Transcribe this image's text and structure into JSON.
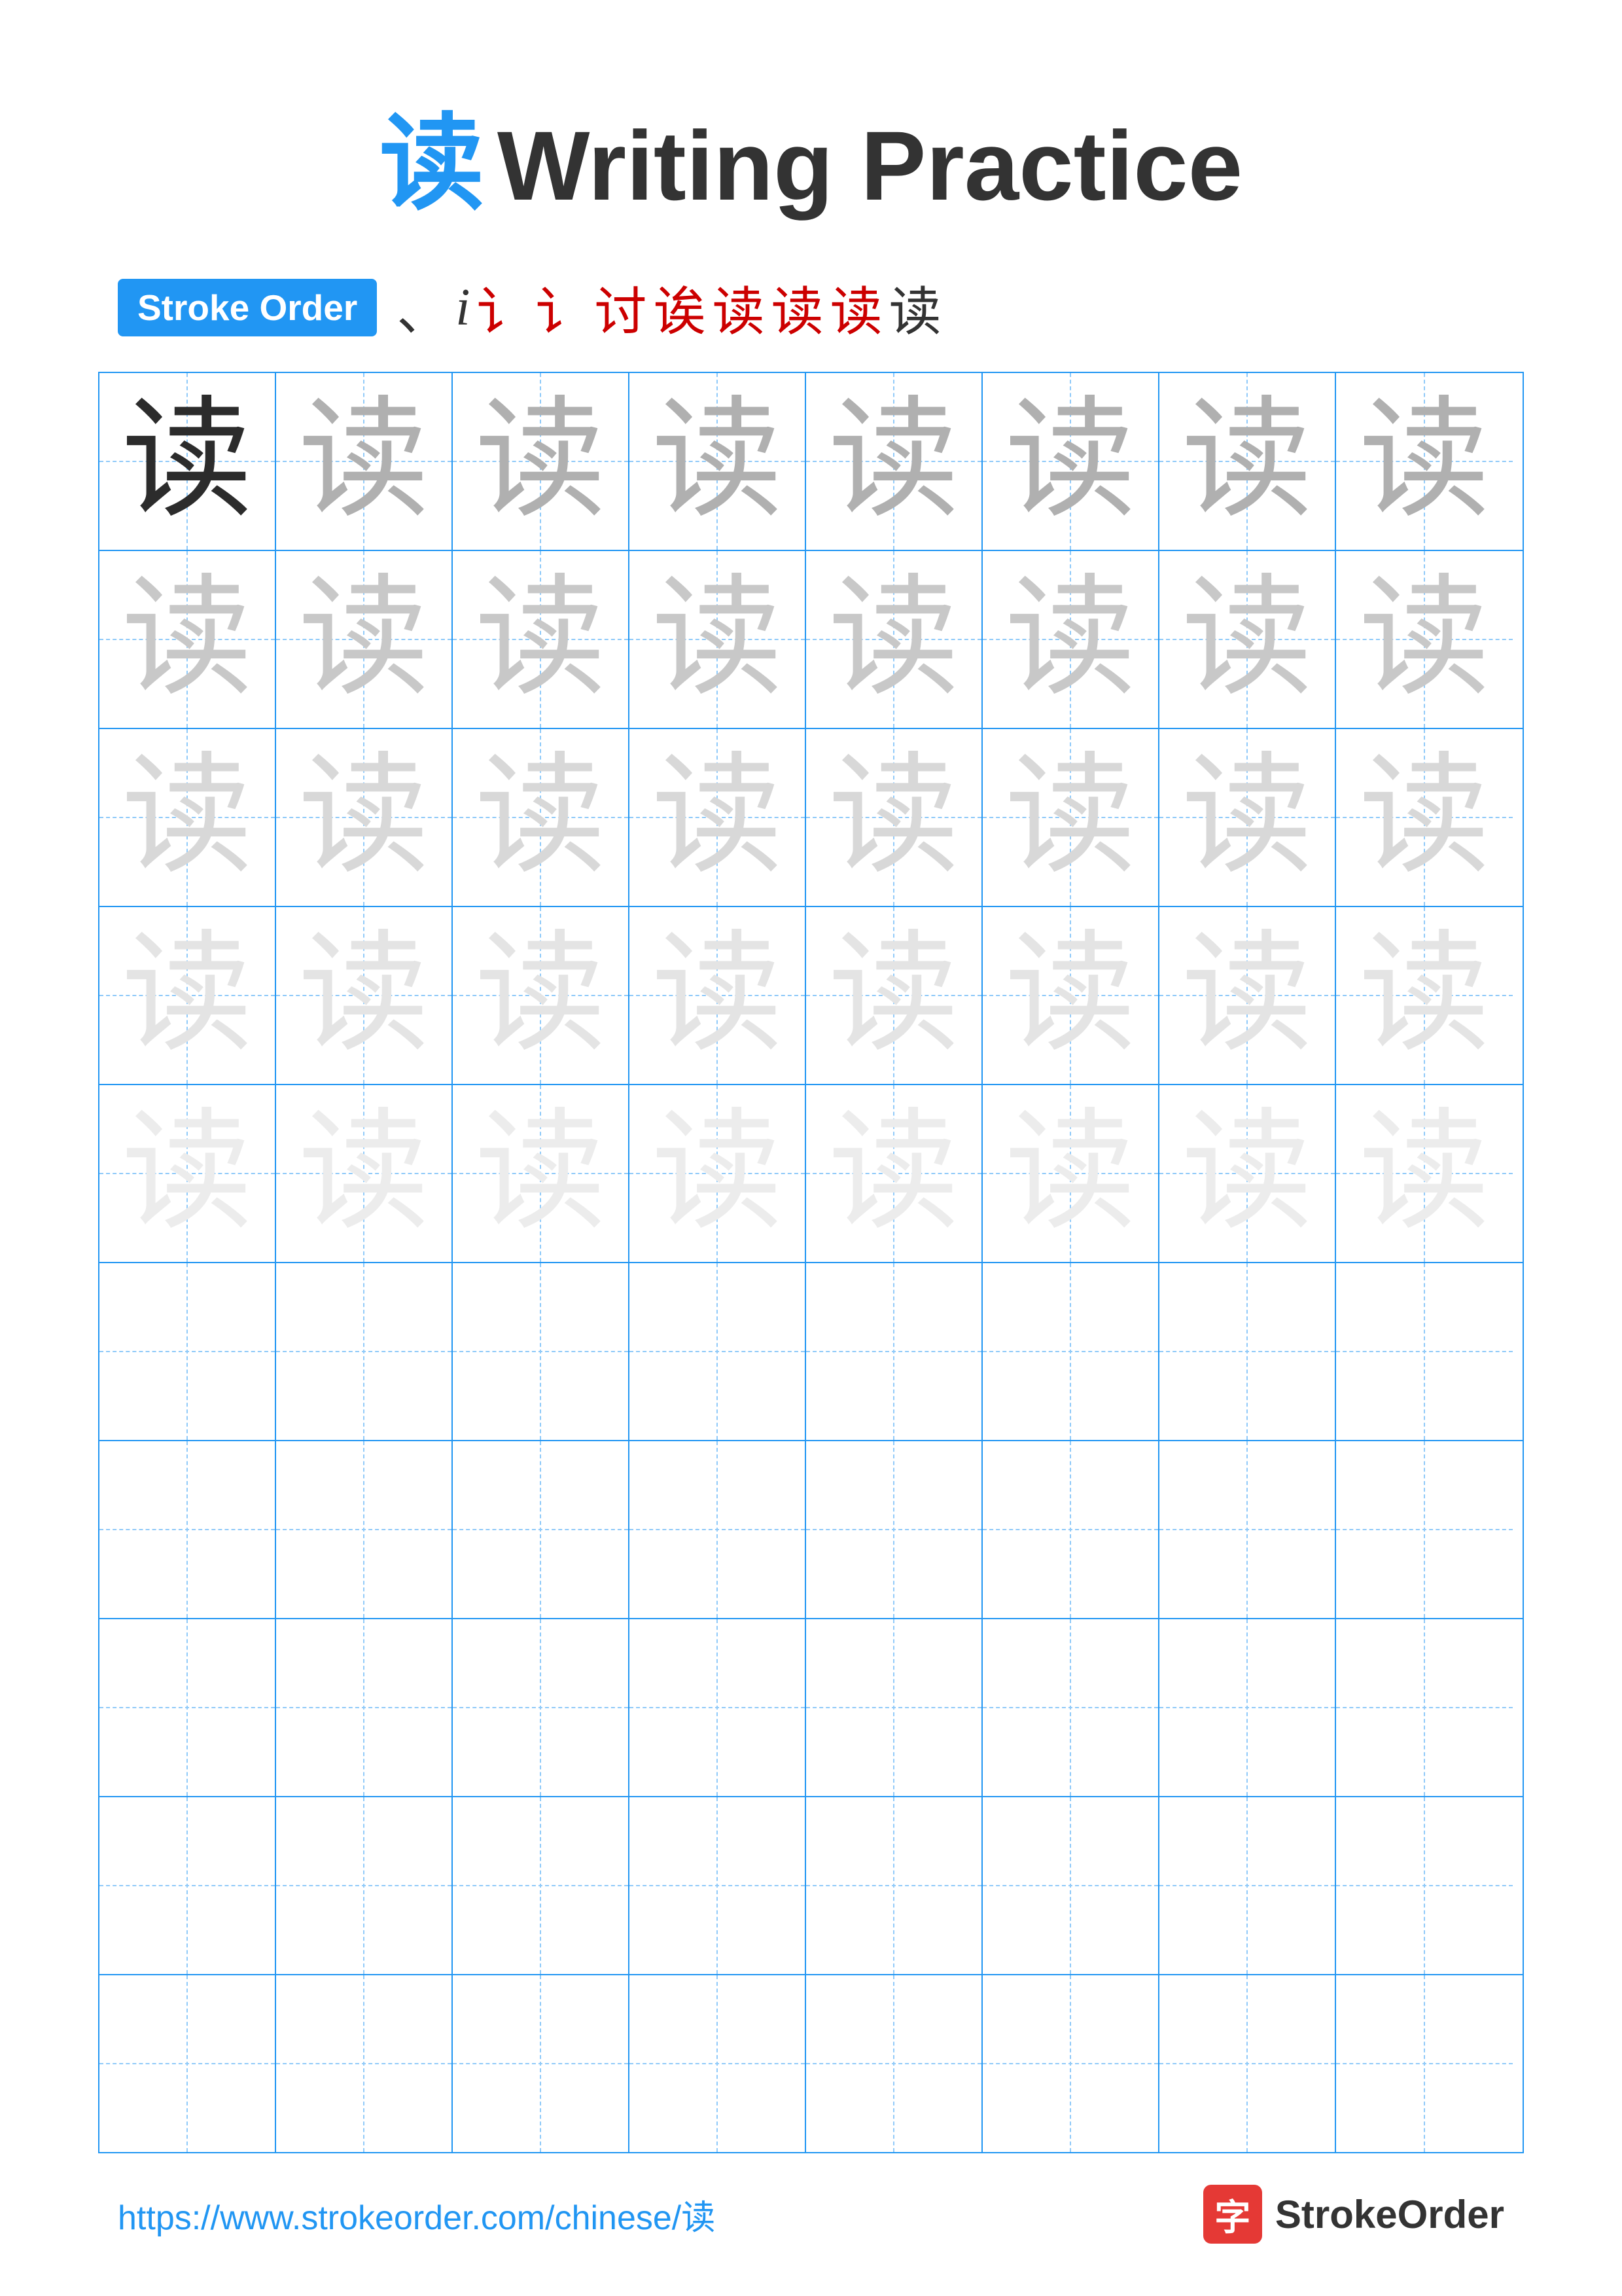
{
  "title": {
    "char": "读",
    "text": "Writing Practice"
  },
  "stroke_order": {
    "badge_label": "Stroke Order",
    "strokes": [
      "、",
      "i",
      "i⁻",
      "i⁺",
      "讠+",
      "讠++",
      "读⁻",
      "读⁻⁻",
      "读"
    ]
  },
  "grid": {
    "rows": 10,
    "cols": 8,
    "char": "读",
    "practice_rows": 5,
    "empty_rows": 5
  },
  "footer": {
    "url": "https://www.strokeorder.com/chinese/读",
    "brand_char": "字",
    "brand_name": "StrokeOrder"
  }
}
